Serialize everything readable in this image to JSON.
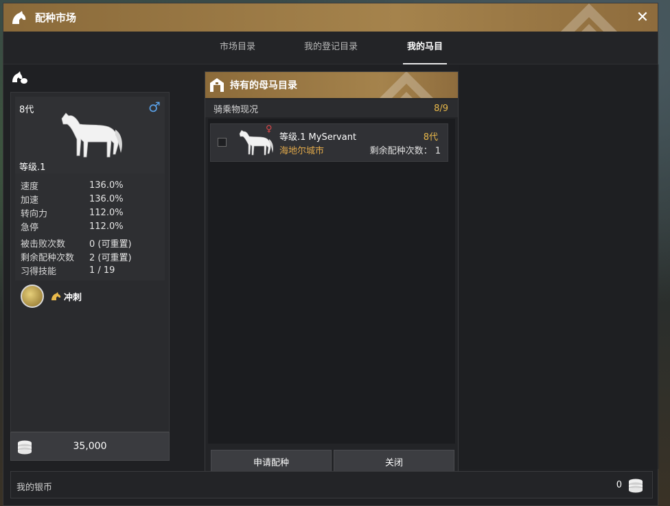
{
  "window": {
    "title": "配种市场"
  },
  "tabs": [
    {
      "label": "市场目录"
    },
    {
      "label": "我的登记目录"
    },
    {
      "label": "我的马目录"
    }
  ],
  "horse": {
    "generation": "8代",
    "level": "等级.1",
    "gender": "male",
    "stats": [
      {
        "key": "速度",
        "value": "136.0%"
      },
      {
        "key": "加速",
        "value": "136.0%"
      },
      {
        "key": "转向力",
        "value": "112.0%"
      },
      {
        "key": "急停",
        "value": "112.0%"
      }
    ],
    "counters": [
      {
        "key": "被击败次数",
        "value": "0 (可重置)"
      },
      {
        "key": "剩余配种次数",
        "value": "2 (可重置)"
      },
      {
        "key": "习得技能",
        "value": "1 / 19"
      }
    ],
    "skill": {
      "name": "冲刺"
    },
    "price": "35,000"
  },
  "mare_panel": {
    "title": "持有的母马目录",
    "status_label": "骑乘物现况",
    "status_count": "8/9",
    "items": [
      {
        "name": "等级.1 MyServant",
        "city": "海地尔城市",
        "generation": "8代",
        "remain": "剩余配种次数： 1"
      }
    ],
    "apply_button": "申请配种",
    "close_button": "关闭"
  },
  "silver": {
    "label": "我的银币",
    "value": "0"
  },
  "colors": {
    "gold_header": "#a5834c",
    "accent_yellow": "#e8b84a",
    "male_blue": "#5aa0e6",
    "female_red": "#e0484a"
  }
}
